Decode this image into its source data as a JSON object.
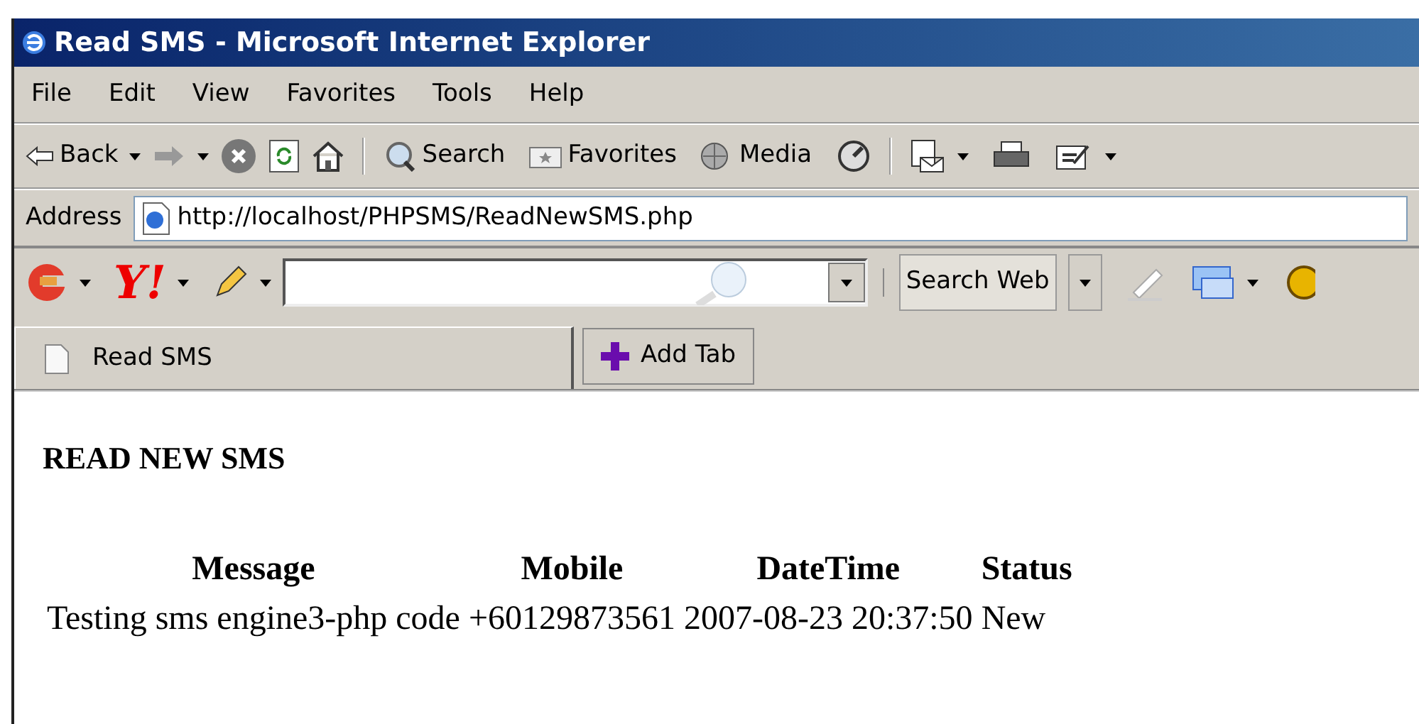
{
  "window": {
    "title": "Read SMS - Microsoft Internet Explorer"
  },
  "menu": [
    "File",
    "Edit",
    "View",
    "Favorites",
    "Tools",
    "Help"
  ],
  "toolbar": {
    "back": "Back",
    "search": "Search",
    "favorites": "Favorites",
    "media": "Media"
  },
  "address": {
    "label": "Address",
    "value": "http://localhost/PHPSMS/ReadNewSMS.php"
  },
  "yahoo_bar": {
    "logo_text": "Y!",
    "search_button": "Search Web"
  },
  "tabs": [
    {
      "label": "Read SMS",
      "selected": true
    }
  ],
  "add_tab": "Add Tab",
  "page": {
    "heading": "READ NEW SMS",
    "table": {
      "columns": [
        "Message",
        "Mobile",
        "DateTime",
        "Status"
      ],
      "rows": [
        [
          "Testing sms engine3-php code",
          "+60129873561",
          "2007-08-23 20:37:50",
          "New"
        ]
      ]
    }
  }
}
